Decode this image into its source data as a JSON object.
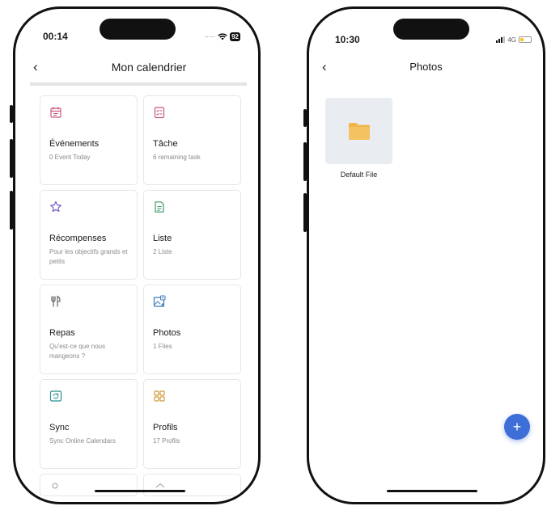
{
  "colors": {
    "accent": "#3e6fd8",
    "events_icon": "#c5567a",
    "task_icon": "#c5567a",
    "rewards_icon": "#7a5bc9",
    "list_icon": "#3f9a6b",
    "meals_icon": "#555555",
    "photos_icon": "#3b7ab8",
    "sync_icon": "#2f8f8f",
    "profiles_icon": "#d09a3a",
    "folder": "#f1b64a"
  },
  "left_screen": {
    "status": {
      "time": "00:14",
      "battery": "92"
    },
    "nav": {
      "title": "Mon calendrier"
    },
    "cards": [
      {
        "title": "Événements",
        "subtitle": "0 Event Today",
        "icon": "calendar-icon"
      },
      {
        "title": "Tâche",
        "subtitle": "6 remaining task",
        "icon": "task-list-icon"
      },
      {
        "title": "Récompenses",
        "subtitle": "Pour les objectifs grands et petits",
        "icon": "star-icon"
      },
      {
        "title": "Liste",
        "subtitle": "2 Liste",
        "icon": "document-icon"
      },
      {
        "title": "Repas",
        "subtitle": "Qu'est-ce que nous mangeons ?",
        "icon": "utensils-icon"
      },
      {
        "title": "Photos",
        "subtitle": "1 Files",
        "icon": "photo-icon"
      },
      {
        "title": "Sync",
        "subtitle": "Sync Online Calendars",
        "icon": "sync-icon"
      },
      {
        "title": "Profils",
        "subtitle": "17 Profils",
        "icon": "grid-icon"
      }
    ]
  },
  "right_screen": {
    "status": {
      "time": "10:30",
      "network": "4G"
    },
    "nav": {
      "title": "Photos"
    },
    "folders": [
      {
        "name": "Default File",
        "icon": "folder-icon"
      }
    ],
    "fab": {
      "label": "+"
    }
  }
}
